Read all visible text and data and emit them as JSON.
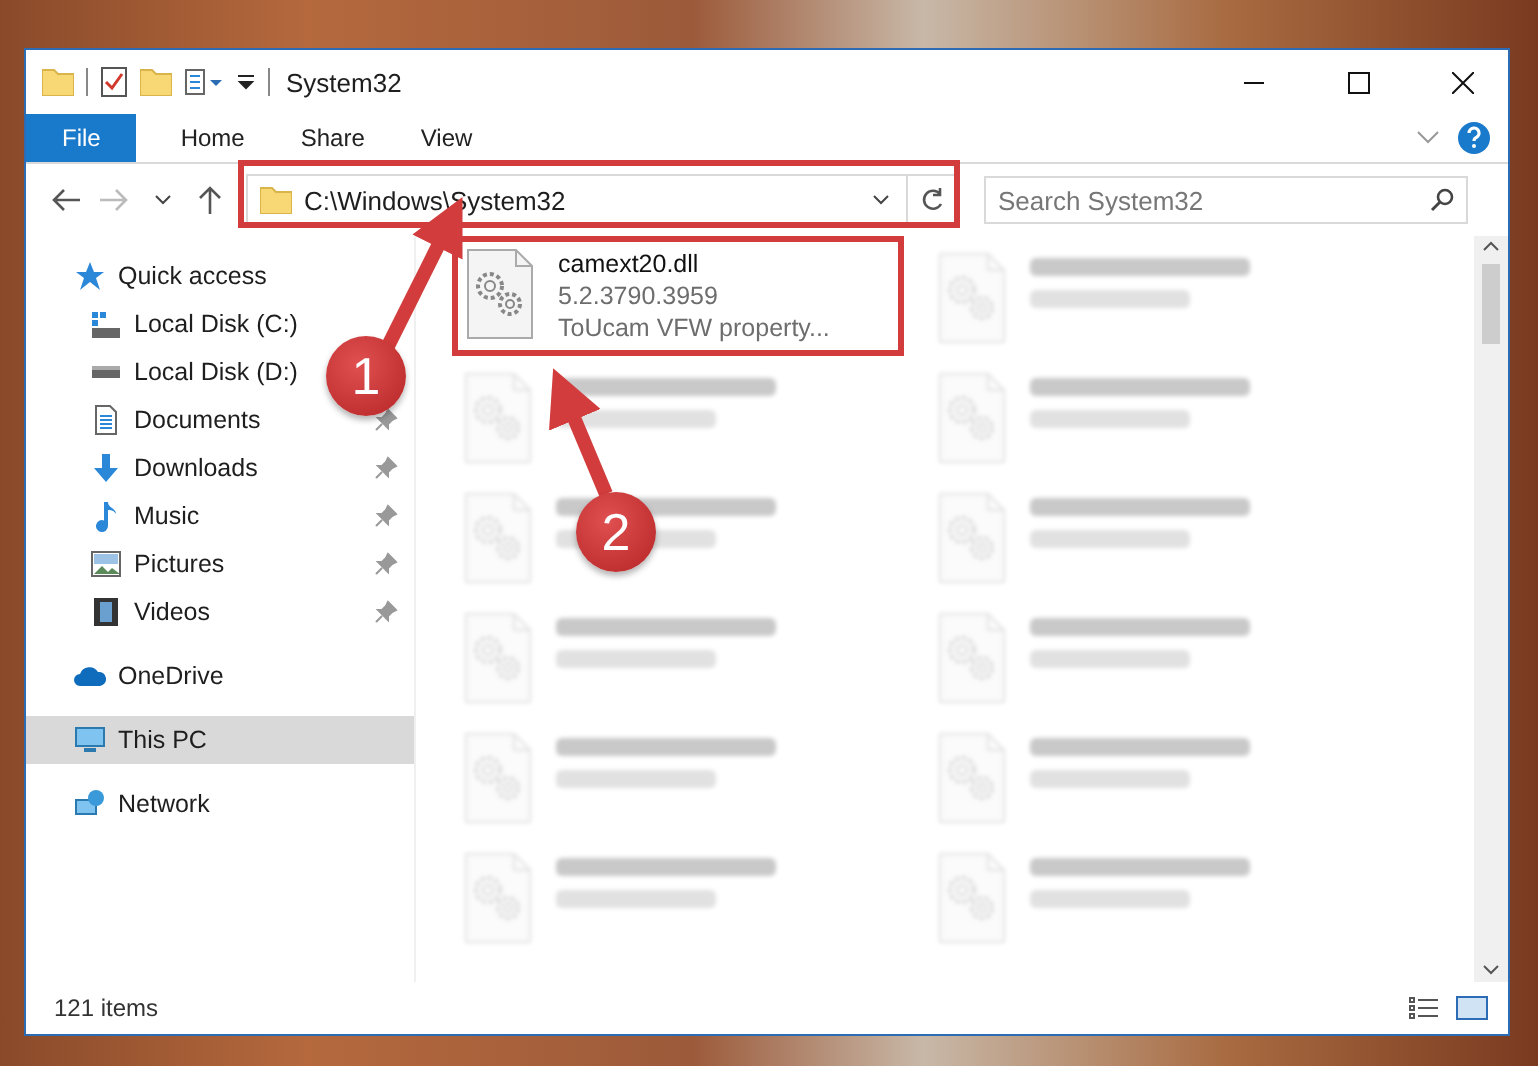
{
  "window": {
    "title": "System32"
  },
  "ribbon_tabs": [
    {
      "label": "File",
      "kind": "file"
    },
    {
      "label": "Home",
      "kind": "tab"
    },
    {
      "label": "Share",
      "kind": "tab"
    },
    {
      "label": "View",
      "kind": "tab"
    }
  ],
  "address": {
    "path": "C:\\Windows\\System32"
  },
  "search": {
    "placeholder": "Search System32"
  },
  "nav": [
    {
      "label": "Quick access",
      "kind": "star",
      "selected": false,
      "children": [
        {
          "label": "Local Disk (C:)",
          "kind": "windows-drive",
          "pinned": false
        },
        {
          "label": "Local Disk (D:)",
          "kind": "drive",
          "pinned": false
        },
        {
          "label": "Documents",
          "kind": "documents",
          "pinned": true
        },
        {
          "label": "Downloads",
          "kind": "downloads",
          "pinned": true
        },
        {
          "label": "Music",
          "kind": "music",
          "pinned": true
        },
        {
          "label": "Pictures",
          "kind": "pictures",
          "pinned": true
        },
        {
          "label": "Videos",
          "kind": "videos",
          "pinned": true
        }
      ]
    },
    {
      "label": "OneDrive",
      "kind": "cloud",
      "selected": false
    },
    {
      "label": "This PC",
      "kind": "computer",
      "selected": true
    },
    {
      "label": "Network",
      "kind": "network",
      "selected": false
    }
  ],
  "files": [
    {
      "name": "camext20.dll",
      "lines": [
        "5.2.3790.3959",
        "ToUcam VFW property..."
      ],
      "blurred": false,
      "highlighted": true
    },
    {
      "blurred": true
    },
    {
      "blurred": true
    },
    {
      "blurred": true
    },
    {
      "blurred": true
    },
    {
      "blurred": true
    },
    {
      "blurred": true
    },
    {
      "blurred": true
    },
    {
      "blurred": true
    },
    {
      "blurred": true
    },
    {
      "blurred": true
    },
    {
      "blurred": true
    }
  ],
  "status_bar": {
    "item_count": "121 items"
  },
  "annotations": [
    {
      "label": "1"
    },
    {
      "label": "2"
    }
  ]
}
